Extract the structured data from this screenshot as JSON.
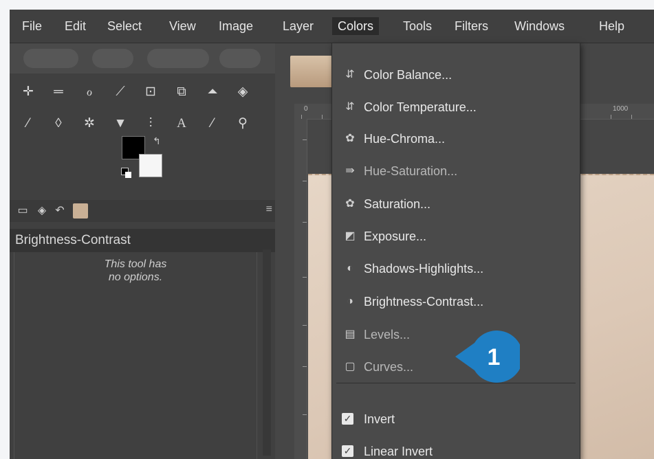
{
  "menubar": {
    "items": [
      {
        "label": "File"
      },
      {
        "label": "Edit"
      },
      {
        "label": "Select"
      },
      {
        "label": "View"
      },
      {
        "label": "Image"
      },
      {
        "label": "Layer"
      },
      {
        "label": "Colors",
        "active": true
      },
      {
        "label": "Tools"
      },
      {
        "label": "Filters"
      },
      {
        "label": "Windows"
      },
      {
        "label": "Help"
      }
    ]
  },
  "toolbox": {
    "tools_row1": [
      "move-icon",
      "align-icon",
      "lasso-icon",
      "fuzzy-select-icon",
      "crop-icon",
      "unified-transform-icon",
      "warp-icon",
      "bucket-fill-icon"
    ],
    "tools_row2": [
      "paintbrush-icon",
      "eraser-icon",
      "heal-icon",
      "clone-icon",
      "paths-icon",
      "text-icon",
      "color-picker-icon",
      "zoom-icon"
    ],
    "tool_options_title": "Brightness-Contrast",
    "tool_options_message": "This tool has\nno options."
  },
  "colors_menu": {
    "items": [
      {
        "label": "Color Balance...",
        "icon": "color-balance-icon"
      },
      {
        "label": "Color Temperature...",
        "icon": "color-temperature-icon"
      },
      {
        "label": "Hue-Chroma...",
        "icon": "hue-chroma-icon"
      },
      {
        "label": "Hue-Saturation...",
        "icon": "hue-saturation-icon"
      },
      {
        "label": "Saturation...",
        "icon": "saturation-icon"
      },
      {
        "label": "Exposure...",
        "icon": "exposure-icon"
      },
      {
        "label": "Shadows-Highlights...",
        "icon": "shadows-highlights-icon"
      },
      {
        "label": "Brightness-Contrast...",
        "icon": "brightness-contrast-icon"
      },
      {
        "label": "Levels...",
        "icon": "levels-icon"
      },
      {
        "label": "Curves...",
        "icon": "curves-icon"
      },
      {
        "label": "Invert",
        "icon": "invert-icon"
      },
      {
        "label": "Linear Invert",
        "icon": "linear-invert-icon"
      }
    ]
  },
  "callout": {
    "number": "1",
    "color": "#1f7fc4"
  },
  "ruler": {
    "labels": [
      "0",
      "1000"
    ]
  },
  "colors": {
    "accent": "#1f7fc4",
    "menu_bg": "#4a4a4a",
    "app_bg": "#3d3d3d"
  }
}
